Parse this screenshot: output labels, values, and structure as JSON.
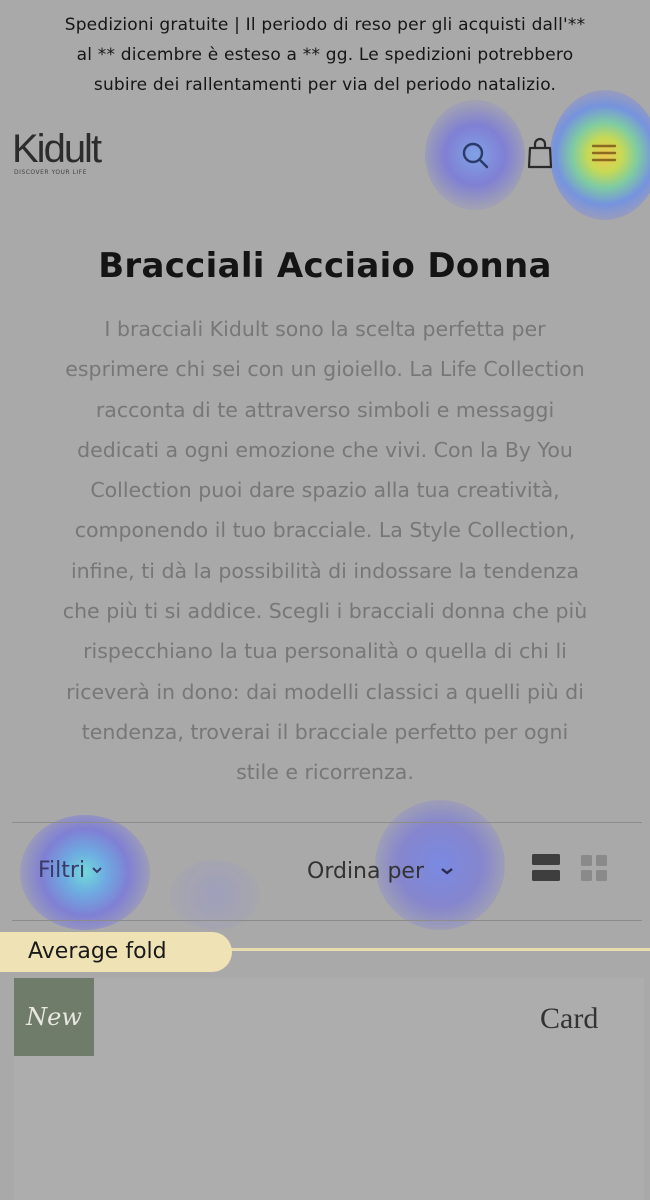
{
  "announcement": {
    "lines": [
      "Spedizioni gratuite | Il periodo di reso per gli acquisti dall'**",
      "al ** dicembre è esteso a ** gg. Le spedizioni potrebbero",
      "subire dei rallentamenti per via del periodo natalizio."
    ]
  },
  "header": {
    "logo_text": "Kidult",
    "logo_tagline": "DISCOVER YOUR LIFE",
    "icons": [
      "search-icon",
      "shopping-bag-icon",
      "hamburger-menu-icon"
    ]
  },
  "page": {
    "title": "Bracciali Acciaio Donna",
    "description_lines": [
      "I bracciali Kidult sono la scelta perfetta per",
      "esprimere chi sei con un gioiello. La Life Collection",
      "racconta di te attraverso simboli e messaggi",
      "dedicati a ogni emozione che vivi. Con la By You",
      "Collection puoi dare spazio alla tua creatività,",
      "componendo il tuo bracciale. La Style Collection,",
      "infine, ti dà la possibilità di indossare la tendenza",
      "che più ti si addice. Scegli i bracciali donna che più",
      "rispecchiano la tua personalità o quella di chi li",
      "riceverà in dono: dai modelli classici a quelli più di",
      "tendenza, troverai il bracciale perfetto per ogni",
      "stile e ricorrenza."
    ]
  },
  "toolbar": {
    "filter_label": "Filtri",
    "sort_label": "Ordina per",
    "view_options": [
      "list-view-icon",
      "grid-view-icon"
    ]
  },
  "overlay": {
    "fold_label": "Average fold"
  },
  "product_card": {
    "badge": "New",
    "label": "Card"
  },
  "colors": {
    "background": "#a9a9a9",
    "fold_tag": "#efe3b6",
    "badge": "#6f7c6a",
    "heat_hot": "#f0c850",
    "heat_cool": "#6e6ee6"
  }
}
